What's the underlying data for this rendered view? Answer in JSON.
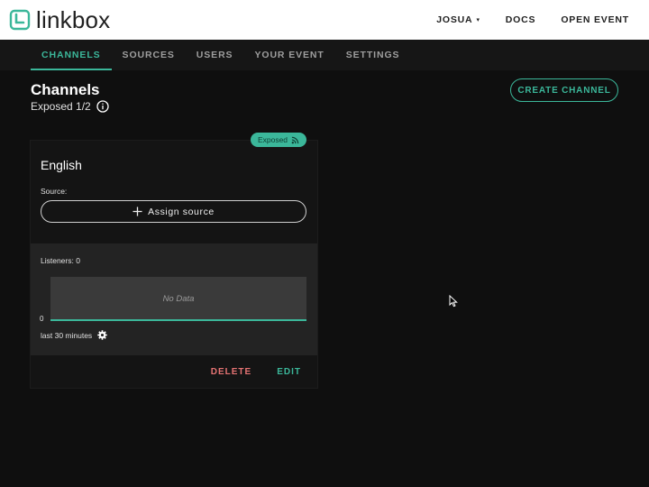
{
  "brand": {
    "name": "linkbox",
    "logo_icon": "linkbox-logo-icon"
  },
  "topnav": {
    "user_label": "JOSUA",
    "user_caret": "▾",
    "docs_label": "DOCS",
    "open_event_label": "OPEN EVENT"
  },
  "tabs": [
    {
      "label": "CHANNELS",
      "active": true
    },
    {
      "label": "SOURCES",
      "active": false
    },
    {
      "label": "USERS",
      "active": false
    },
    {
      "label": "YOUR EVENT",
      "active": false
    },
    {
      "label": "SETTINGS",
      "active": false
    }
  ],
  "page": {
    "title": "Channels",
    "exposed_text": "Exposed 1/2",
    "create_label": "CREATE CHANNEL"
  },
  "channel": {
    "badge": "Exposed",
    "name": "English",
    "source_label": "Source:",
    "assign_label": "Assign source",
    "listeners_label": "Listeners: 0",
    "chart_empty": "No Data",
    "chart_zero": "0",
    "range_label": "last 30 minutes",
    "delete_label": "DELETE",
    "edit_label": "EDIT"
  },
  "colors": {
    "accent": "#3bb79a",
    "danger": "#e57373",
    "background": "#0f0f0f",
    "header": "#ffffff"
  }
}
